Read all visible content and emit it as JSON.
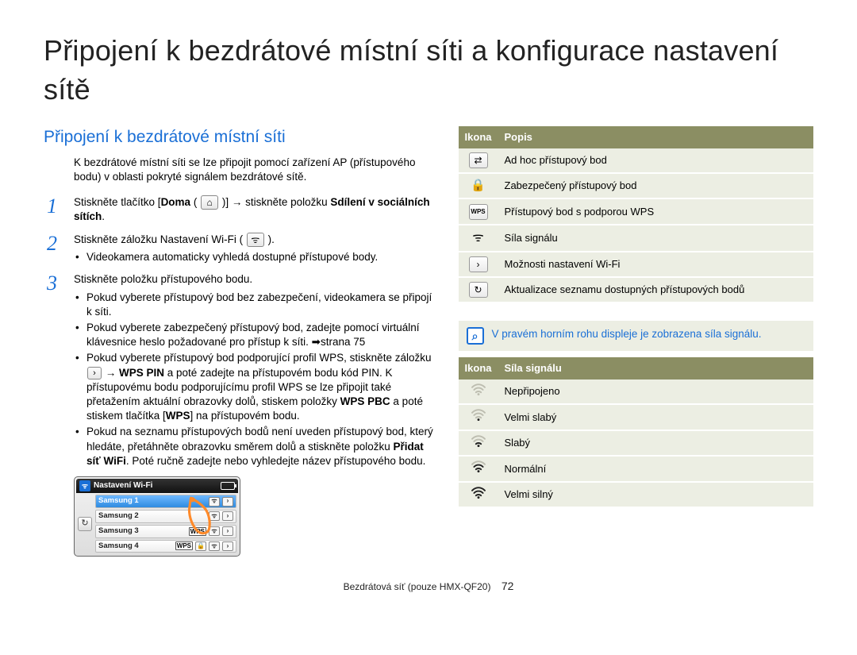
{
  "pageTitle": "Připojení k bezdrátové místní síti a konfigurace nastavení sítě",
  "sectionTitle": "Připojení k bezdrátové místní síti",
  "intro": "K bezdrátové místní síti se lze připojit pomocí zařízení AP (přístupového bodu) v oblasti pokryté signálem bezdrátové sítě.",
  "steps": {
    "s1_a": "Stiskněte tlačítko [",
    "s1_b": "Doma",
    "s1_c": " ( ",
    "s1_home": "⌂",
    "s1_d": " )] → stiskněte položku ",
    "s1_e": "Sdílení v sociálních sítích",
    "s1_f": ".",
    "s2_a": "Stiskněte záložku Nastavení Wi-Fi ( ",
    "s2_wifi": "ᯤ",
    "s2_b": " ).",
    "s2_sub": "Videokamera automaticky vyhledá dostupné přístupové body.",
    "s3_a": "Stiskněte položku přístupového bodu.",
    "s3_b1": "Pokud vyberete přístupový bod bez zabezpečení, videokamera se připojí k síti.",
    "s3_b2": "Pokud vyberete zabezpečený přístupový bod, zadejte pomocí virtuální klávesnice heslo požadované pro přístup k síti. ➡strana 75",
    "s3_b3_a": "Pokud vyberete přístupový bod podporující profil WPS, stiskněte záložku ",
    "s3_b3_icon": "›",
    "s3_b3_b": " → ",
    "s3_b3_c": "WPS PIN",
    "s3_b3_d": " a poté zadejte na přístupovém bodu kód PIN. K přístupovému bodu podporujícímu profil WPS se lze připojit také přetažením aktuální obrazovky dolů, stiskem položky ",
    "s3_b3_e": "WPS PBC",
    "s3_b3_f": " a poté stiskem tlačítka [",
    "s3_b3_g": "WPS",
    "s3_b3_h": "] na přístupovém bodu.",
    "s3_b4_a": "Pokud na seznamu přístupových bodů není uveden přístupový bod, který hledáte, přetáhněte obrazovku směrem dolů a stiskněte položku ",
    "s3_b4_b": "Přidat síť WiFi",
    "s3_b4_c": ". Poté ručně zadejte nebo vyhledejte název přístupového bodu."
  },
  "device": {
    "title": "Nastavení Wi-Fi",
    "rows": [
      "Samsung 1",
      "Samsung 2",
      "Samsung 3",
      "Samsung 4"
    ],
    "refresh": "↻"
  },
  "iconTable": {
    "h1": "Ikona",
    "h2": "Popis",
    "rows": [
      {
        "iconText": "⇄",
        "desc": "Ad hoc přístupový bod"
      },
      {
        "iconText": "🔒",
        "desc": "Zabezpečený přístupový bod"
      },
      {
        "iconText": "WPS",
        "desc": "Přístupový bod s podporou WPS"
      },
      {
        "iconText": "ᯤ",
        "desc": "Síla signálu"
      },
      {
        "iconText": "›",
        "desc": "Možnosti nastavení Wi-Fi"
      },
      {
        "iconText": "↻",
        "desc": "Aktualizace seznamu dostupných přístupových bodů"
      }
    ]
  },
  "note": "V pravém horním rohu displeje je zobrazena síla signálu.",
  "signalTable": {
    "h1": "Ikona",
    "h2": "Síla signálu",
    "rows": [
      {
        "bars": 0,
        "label": "Nepřipojeno"
      },
      {
        "bars": 1,
        "label": "Velmi slabý"
      },
      {
        "bars": 2,
        "label": "Slabý"
      },
      {
        "bars": 3,
        "label": "Normální"
      },
      {
        "bars": 4,
        "label": "Velmi silný"
      }
    ]
  },
  "footer": {
    "text": "Bezdrátová síť (pouze HMX-QF20)",
    "page": "72"
  }
}
